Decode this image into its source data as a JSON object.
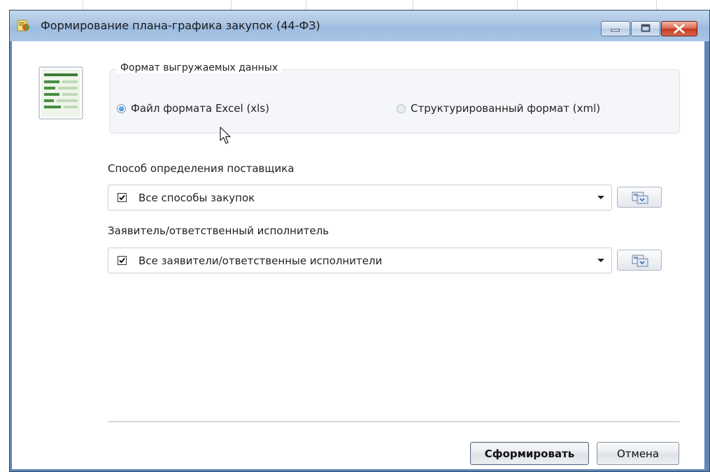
{
  "window": {
    "title": "Формирование плана-графика закупок (44-ФЗ)",
    "controls": [
      "minimize-icon",
      "maximize-icon",
      "close-icon"
    ]
  },
  "export_format": {
    "legend": "Формат выгружаемых данных",
    "options": [
      {
        "label": "Файл формата Excel (xls)",
        "selected": true
      },
      {
        "label": "Структурированный формат (xml)",
        "selected": false
      }
    ]
  },
  "supplier_method": {
    "label": "Способ определения поставщика",
    "value": "Все способы закупок",
    "checked": true
  },
  "applicant": {
    "label": "Заявитель/ответственный исполнитель",
    "value": "Все заявители/ответственные исполнители",
    "checked": true
  },
  "buttons": {
    "generate": "Сформировать",
    "cancel": "Отмена"
  },
  "colors": {
    "titlebar": "#aac4e2",
    "close_button": "#c5391f",
    "window_border": "#5f86b6"
  }
}
